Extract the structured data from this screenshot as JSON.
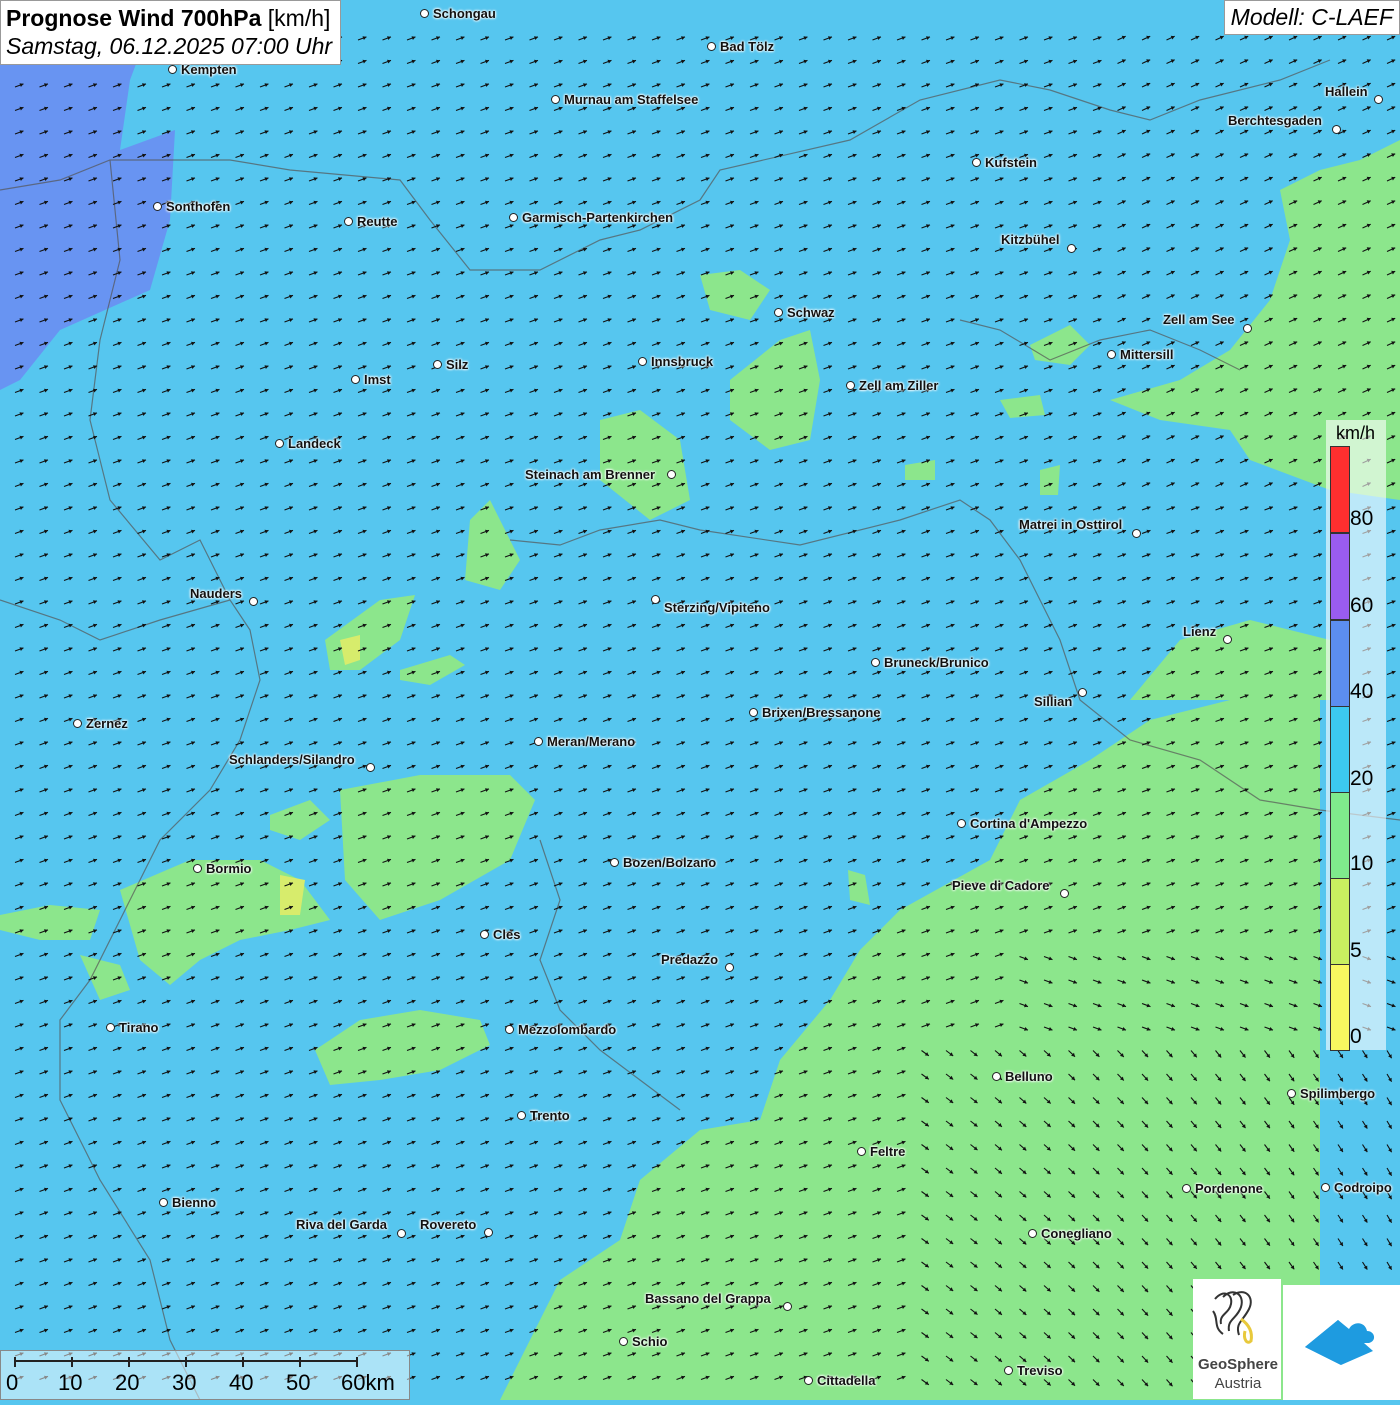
{
  "title": {
    "main": "Prognose Wind 700hPa",
    "unit": "[km/h]",
    "datetime": "Samstag, 06.12.2025 07:00 Uhr"
  },
  "model": "Modell: C-LAEF",
  "legend": {
    "unit": "km/h",
    "ticks": [
      "80",
      "60",
      "40",
      "20",
      "10",
      "5",
      "0"
    ],
    "colors": [
      "#ff2f2f",
      "#9a5cf0",
      "#5c8ef0",
      "#3cc8f0",
      "#7fea8c",
      "#c8f060",
      "#f8f860"
    ]
  },
  "scale": {
    "labels": [
      "0",
      "10",
      "20",
      "30",
      "40",
      "50",
      "60km"
    ]
  },
  "logo": {
    "name": "GeoSphere",
    "sub": "Austria"
  },
  "colors": {
    "sea_blue": "#56c6ef",
    "light_green": "#8ce68c",
    "dark_blue": "#6a8ef2"
  },
  "cities": [
    {
      "name": "Schongau"
    },
    {
      "name": "Bad Tölz"
    },
    {
      "name": "Kempten"
    },
    {
      "name": "Murnau am Staffelsee"
    },
    {
      "name": "Hallein"
    },
    {
      "name": "Berchtesgaden"
    },
    {
      "name": "Kufstein"
    },
    {
      "name": "Sonthofen"
    },
    {
      "name": "Reutte"
    },
    {
      "name": "Garmisch-Partenkirchen"
    },
    {
      "name": "Kitzbühel"
    },
    {
      "name": "Schwaz"
    },
    {
      "name": "Zell am See"
    },
    {
      "name": "Mittersill"
    },
    {
      "name": "Innsbruck"
    },
    {
      "name": "Imst"
    },
    {
      "name": "Silz"
    },
    {
      "name": "Zell am Ziller"
    },
    {
      "name": "Landeck"
    },
    {
      "name": "Steinach am Brenner"
    },
    {
      "name": "Matrei in Osttirol"
    },
    {
      "name": "Nauders"
    },
    {
      "name": "Sterzing/Vipiteno"
    },
    {
      "name": "Lienz"
    },
    {
      "name": "Bruneck/Brunico"
    },
    {
      "name": "Sillian"
    },
    {
      "name": "Brixen/Bressanone"
    },
    {
      "name": "Zernez"
    },
    {
      "name": "Meran/Merano"
    },
    {
      "name": "Schlanders/Silandro"
    },
    {
      "name": "Cortina d'Ampezzo"
    },
    {
      "name": "Bozen/Bolzano"
    },
    {
      "name": "Bormio"
    },
    {
      "name": "Pieve di Cadore"
    },
    {
      "name": "Cles"
    },
    {
      "name": "Predazzo"
    },
    {
      "name": "Tirano"
    },
    {
      "name": "Mezzolombardo"
    },
    {
      "name": "Belluno"
    },
    {
      "name": "Spilimbergo"
    },
    {
      "name": "Trento"
    },
    {
      "name": "Feltre"
    },
    {
      "name": "Pordenone"
    },
    {
      "name": "Codroipo"
    },
    {
      "name": "Bienno"
    },
    {
      "name": "Riva del Garda"
    },
    {
      "name": "Rovereto"
    },
    {
      "name": "Conegliano"
    },
    {
      "name": "Bassano del Grappa"
    },
    {
      "name": "Schio"
    },
    {
      "name": "Treviso"
    },
    {
      "name": "Cittadella"
    }
  ]
}
